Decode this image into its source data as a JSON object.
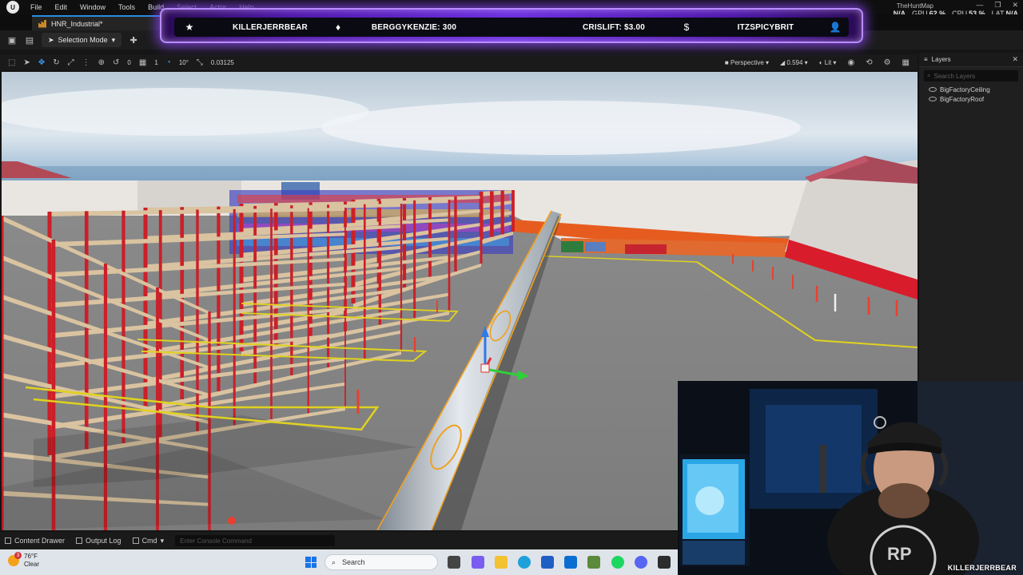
{
  "menu": {
    "items": [
      "File",
      "Edit",
      "Window",
      "Tools",
      "Build",
      "Select",
      "Actor",
      "Help"
    ],
    "project_title": "TheHuntMap"
  },
  "perf": {
    "cut_value": "N/A",
    "gpu_label": "GPU",
    "gpu_value": "62 %",
    "cpu_label": "CPU",
    "cpu_value": "53 %",
    "lat_label": "LAT",
    "lat_value": "N/A"
  },
  "tab": {
    "title": "HNR_Industrial*"
  },
  "toolbar": {
    "mode_label": "Selection Mode"
  },
  "viewport_toolbar": {
    "rotation_snap": "0",
    "scale_snap": "1",
    "angle_snap": "10°",
    "scale_value": "0.03125",
    "view_mode": "Perspective",
    "fov": "0.594",
    "lit_mode": "Lit"
  },
  "layers": {
    "title": "Layers",
    "search_placeholder": "Search Layers",
    "items": [
      "BigFactoryCeiling",
      "BigFactoryRoof"
    ]
  },
  "overlay": {
    "follower": "KILLERJERRBEAR",
    "sub": "BERGGYKENZIE: 300",
    "donation": "CRISLIFT: $3.00",
    "host": "ITZSPICYBRIT"
  },
  "statusbar": {
    "content_drawer": "Content Drawer",
    "output_log": "Output Log",
    "cmd": "Cmd",
    "console_placeholder": "Enter Console Command"
  },
  "taskbar": {
    "temp": "76°F",
    "condition": "Clear",
    "badge": "3",
    "search": "Search"
  },
  "webcam": {
    "name": "KILLERJERRBEAR"
  },
  "colors": {
    "rack_red": "#cc1f28",
    "shelf_wood": "#d9c3a0",
    "floor_line": "#e0d21e",
    "overlay_purple": "#6a2ee0",
    "editor_bg": "#1c1c1c"
  }
}
